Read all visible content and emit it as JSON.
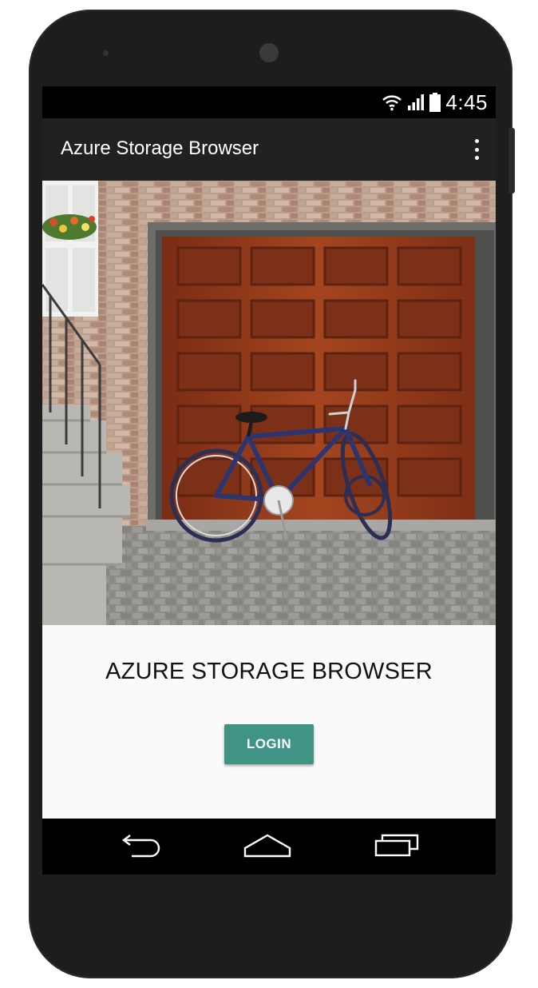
{
  "status_bar": {
    "time": "4:45",
    "icons": [
      "wifi-icon",
      "signal-icon",
      "battery-icon"
    ]
  },
  "app_bar": {
    "title": "Azure Storage Browser",
    "menu_icon": "overflow-menu-icon"
  },
  "hero_image": {
    "subject": "bicycle in front of garage door"
  },
  "main": {
    "heading": "AZURE STORAGE BROWSER",
    "login_label": "LOGIN"
  },
  "nav_bar": {
    "icons": [
      "back-icon",
      "home-icon",
      "recents-icon"
    ]
  },
  "colors": {
    "app_bar": "#212121",
    "button": "#3f9485",
    "content_bg": "#fafafa"
  }
}
